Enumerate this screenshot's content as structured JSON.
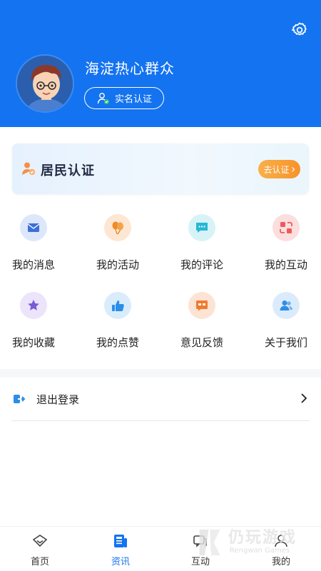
{
  "profile": {
    "name": "海淀热心群众",
    "verify_label": "实名认证"
  },
  "resident_card": {
    "title": "居民认证",
    "button_label": "去认证"
  },
  "menu": [
    {
      "label": "我的消息",
      "icon": "message-icon",
      "color": "#dde7fb"
    },
    {
      "label": "我的活动",
      "icon": "activity-balloon-icon",
      "color": "#fde7d3"
    },
    {
      "label": "我的评论",
      "icon": "comment-icon",
      "color": "#d7f3f7"
    },
    {
      "label": "我的互动",
      "icon": "interaction-icon",
      "color": "#fcdede"
    },
    {
      "label": "我的收藏",
      "icon": "favorite-star-icon",
      "color": "#ece4fb"
    },
    {
      "label": "我的点赞",
      "icon": "thumbs-up-icon",
      "color": "#d9ecfc"
    },
    {
      "label": "意见反馈",
      "icon": "feedback-icon",
      "color": "#fde3d3"
    },
    {
      "label": "关于我们",
      "icon": "about-us-icon",
      "color": "#dcebfb"
    }
  ],
  "logout": {
    "label": "退出登录"
  },
  "tabs": [
    {
      "label": "首页",
      "icon": "home-icon"
    },
    {
      "label": "资讯",
      "icon": "news-icon",
      "active": true
    },
    {
      "label": "互动",
      "icon": "interact-icon"
    },
    {
      "label": "我的",
      "icon": "mine-icon"
    }
  ],
  "watermark": {
    "text": "仍玩游戏",
    "sub": "Rengwan Games"
  },
  "colors": {
    "primary": "#1473f0",
    "orange": "#f7932a"
  }
}
